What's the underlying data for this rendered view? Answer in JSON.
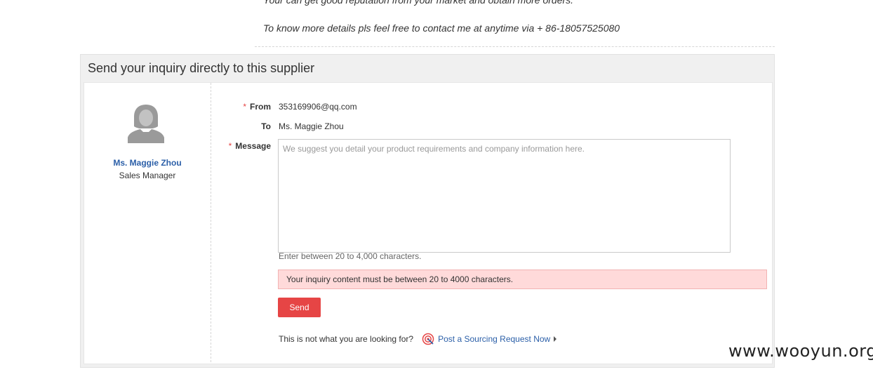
{
  "intro": {
    "line1": "Your can get good reputation from your market and obtain more orders.",
    "line2": "To know more details pls feel free to contact me at anytime via + 86-18057525080"
  },
  "inquiry": {
    "title": "Send your inquiry directly to this supplier",
    "contact": {
      "avatar_icon": "person-silhouette-icon",
      "name": "Ms. Maggie Zhou",
      "role": "Sales Manager"
    },
    "form": {
      "from_label": "From",
      "from_value": "353169906@qq.com",
      "to_label": "To",
      "to_value": "Ms. Maggie Zhou",
      "message_label": "Message",
      "required_mark": "*",
      "message_value": "",
      "message_placeholder": "We suggest you detail your product requirements and company information here.",
      "hint": "Enter between 20 to 4,000 characters.",
      "error": "Your inquiry content must be between 20 to 4000 characters.",
      "send_label": "Send"
    },
    "footer": {
      "prompt": "This is not what you are looking for?",
      "icon": "target-icon",
      "link": "Post a Sourcing Request Now",
      "arrow_icon": "arrow-right-icon"
    }
  },
  "watermark": "www.wooyun.org",
  "colors": {
    "accent_red": "#e64545",
    "link_blue": "#2b5fa8",
    "error_bg": "#ffdada"
  }
}
